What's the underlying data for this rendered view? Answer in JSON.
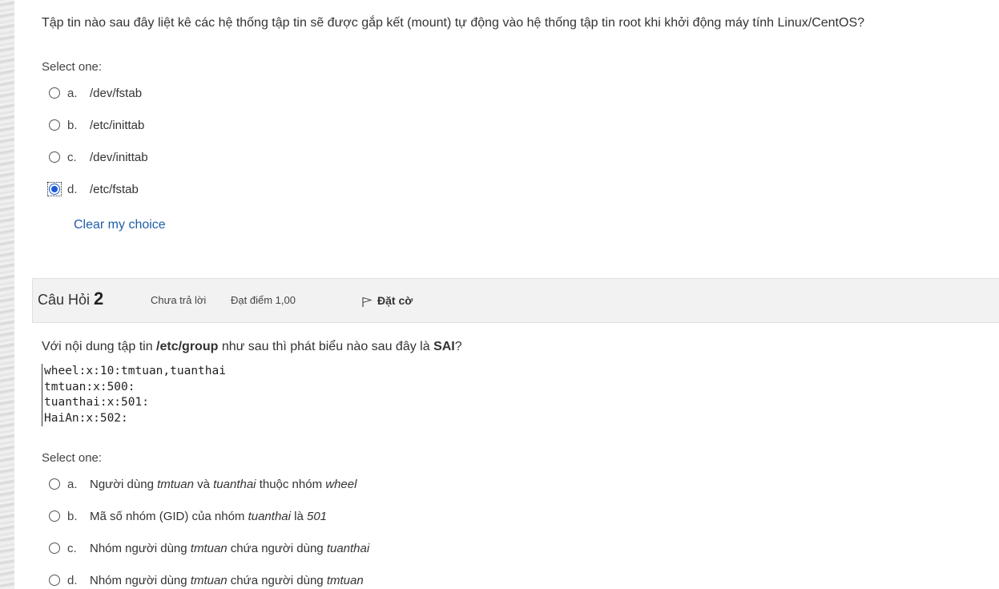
{
  "q1": {
    "text": "Tập tin nào sau đây liệt kê các hệ thống tập tin sẽ được gắp kết (mount) tự động vào hệ thống tập tin root khi khởi động máy tính Linux/CentOS?",
    "prompt": "Select one:",
    "options": [
      {
        "letter": "a.",
        "text": "/dev/fstab",
        "selected": false
      },
      {
        "letter": "b.",
        "text": "/etc/inittab",
        "selected": false
      },
      {
        "letter": "c.",
        "text": "/dev/inittab",
        "selected": false
      },
      {
        "letter": "d.",
        "text": "/etc/fstab",
        "selected": true
      }
    ],
    "clear_label": "Clear my choice"
  },
  "q2_header": {
    "title_prefix": "Câu Hỏi",
    "number": "2",
    "state": "Chưa trả lời",
    "grade": "Đạt điểm 1,00",
    "flag_label": "Đặt cờ"
  },
  "q2": {
    "text_1": "Với nội dung tập tin ",
    "text_file": "/etc/group",
    "text_2": " như sau thì phát biểu nào sau đây là ",
    "text_sai": "SAI",
    "text_3": "?",
    "code_lines": [
      "wheel:x:10:tmtuan,tuanthai",
      "tmtuan:x:500:",
      "tuanthai:x:501:",
      "HaiAn:x:502:"
    ],
    "prompt": "Select one:",
    "options": [
      {
        "letter": "a.",
        "parts": [
          "Người dùng ",
          "tmtuan",
          " và ",
          "tuanthai",
          " thuộc nhóm ",
          "wheel"
        ]
      },
      {
        "letter": "b.",
        "parts": [
          "Mã số nhóm (GID) của nhóm ",
          "tuanthai",
          " là ",
          "501"
        ]
      },
      {
        "letter": "c.",
        "parts": [
          "Nhóm người dùng ",
          "tmtuan",
          " chứa người dùng ",
          "tuanthai"
        ]
      },
      {
        "letter": "d.",
        "parts": [
          "Nhóm người dùng ",
          "tmtuan",
          " chứa người dùng ",
          "tmtuan"
        ]
      }
    ]
  }
}
